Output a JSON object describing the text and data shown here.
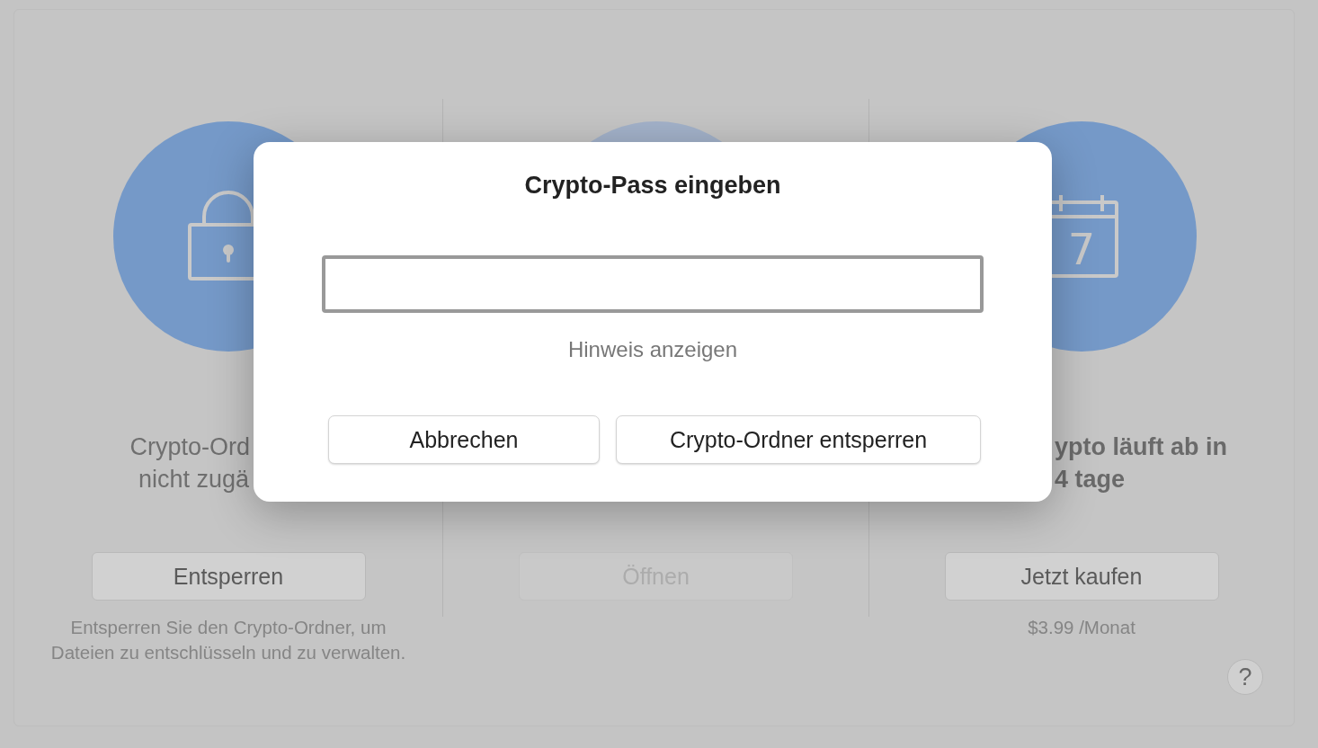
{
  "background": {
    "columns": [
      {
        "kind": "lock",
        "disabled": false,
        "emphasized": false,
        "title_lines": [
          "Crypto-Ord",
          "nicht zugä"
        ],
        "button": {
          "label": "Entsperren",
          "disabled": false
        },
        "caption": "Entsperren Sie den Crypto-Ordner, um Dateien zu entschlüsseln und zu verwalten."
      },
      {
        "disabled": true,
        "button": {
          "label": "Öffnen",
          "disabled": true
        }
      },
      {
        "kind": "calendar",
        "icon_text": "7",
        "disabled": false,
        "emphasized": true,
        "title_lines": [
          "ypto läuft ab in",
          "4 tage"
        ],
        "button": {
          "label": "Jetzt kaufen",
          "disabled": false
        },
        "caption": "$3.99 /Monat"
      }
    ],
    "help_button": "?"
  },
  "dialog": {
    "title": "Crypto-Pass eingeben",
    "hint_link": "Hinweis anzeigen",
    "buttons": [
      "Abbrechen",
      "Crypto-Ordner entsperren"
    ]
  }
}
